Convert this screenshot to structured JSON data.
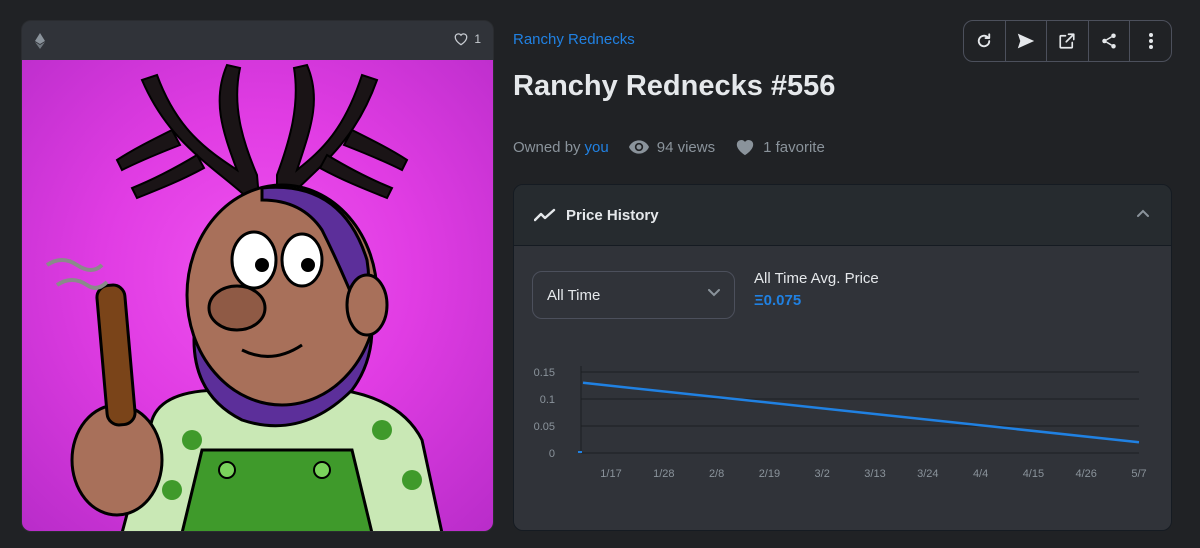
{
  "nft_card": {
    "favorite_count": "1",
    "chain_icon": "ethereum-icon",
    "image_subject": "cartoon redneck character with antlers holding cigar"
  },
  "header": {
    "collection": "Ranchy Rednecks",
    "title": "Ranchy Rednecks #556"
  },
  "ownership": {
    "owned_by_label": "Owned by",
    "owner": "you",
    "views": "94 views",
    "favorites": "1 favorite"
  },
  "toolbar": {
    "buttons": [
      "refresh-icon",
      "send-icon",
      "external-link-icon",
      "share-icon",
      "more-icon"
    ]
  },
  "price_history": {
    "title": "Price History",
    "range_select": "All Time",
    "avg_label": "All Time Avg. Price",
    "avg_value": "Ξ0.075"
  },
  "colors": {
    "background": "#202225",
    "accent": "#2081e2",
    "line": "#2081e2",
    "art_bg": "#e03ce3"
  },
  "chart_data": {
    "type": "line",
    "title": "",
    "xlabel": "",
    "ylabel": "",
    "x_ticks": [
      "1/17",
      "1/28",
      "2/8",
      "2/19",
      "3/2",
      "3/13",
      "3/24",
      "4/4",
      "4/15",
      "4/26",
      "5/7"
    ],
    "y_ticks": [
      "0",
      "0.05",
      "0.1",
      "0.15"
    ],
    "ylim": [
      0,
      0.15
    ],
    "series": [
      {
        "points": [
          {
            "x": "1/12",
            "y": 0.13
          },
          {
            "x": "5/7",
            "y": 0.02
          }
        ]
      }
    ],
    "grid": true
  }
}
